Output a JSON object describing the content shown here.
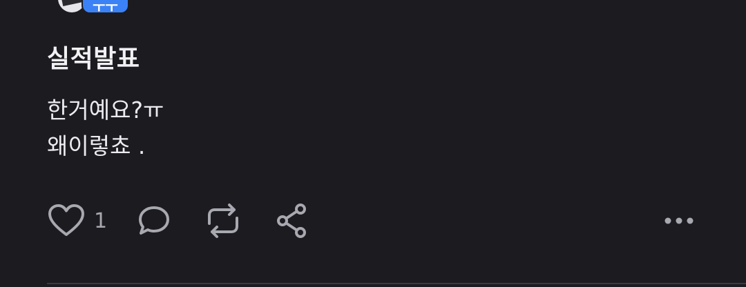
{
  "author": {
    "badge_label": "ㅜㅜ"
  },
  "post": {
    "title": "실적발표",
    "body_lines": [
      "한거예요?ㅠ",
      "왜이렇쵸 ."
    ]
  },
  "actions": {
    "like_count": "1",
    "like_icon": "heart-icon",
    "comment_icon": "comment-bubble-icon",
    "repost_icon": "repost-icon",
    "share_icon": "share-icon",
    "more_icon": "more-dots-icon"
  },
  "colors": {
    "background": "#1c1b20",
    "text_primary": "#ececf0",
    "icon_gray": "#a8a8b0",
    "badge_blue": "#3b82f6"
  }
}
